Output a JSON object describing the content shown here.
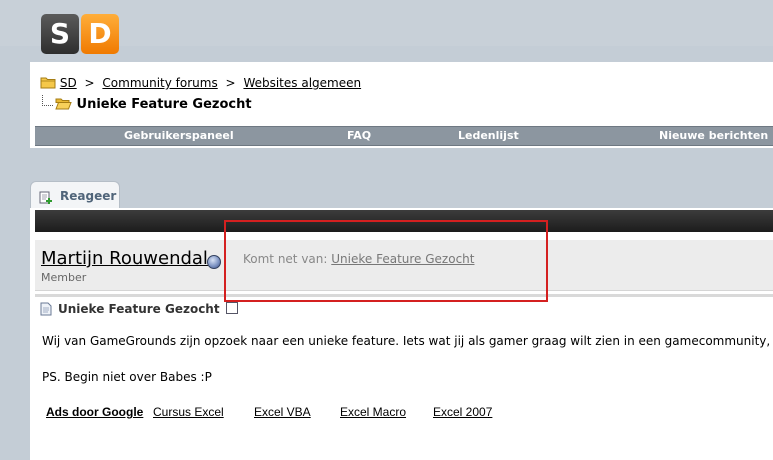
{
  "logo": {
    "letter1": "S",
    "letter2": "D"
  },
  "breadcrumb": {
    "items": [
      "SD",
      "Community forums",
      "Websites algemeen"
    ],
    "separator": ">",
    "current": "Unieke Feature Gezocht"
  },
  "nav": {
    "items": [
      "Gebruikerspaneel",
      "FAQ",
      "Ledenlijst",
      "Nieuwe berichten"
    ]
  },
  "tab": {
    "label": "Reageer"
  },
  "post": {
    "username": "Martijn Rouwendal",
    "role": "Member",
    "from_label": "Komt net van:",
    "from_link": "Unieke Feature Gezocht",
    "title": "Unieke Feature Gezocht",
    "body": "Wij van GameGrounds zijn opzoek naar een unieke feature. Iets wat jij als gamer graag wilt zien in een gamecommunity, m",
    "ps": "PS. Begin niet over Babes :P"
  },
  "ads": {
    "label": "Ads door Google",
    "links": [
      "Cursus Excel",
      "Excel VBA",
      "Excel Macro",
      "Excel 2007"
    ]
  },
  "colors": {
    "highlight": "#d42020",
    "accent": "#f07a00",
    "nav_bg": "#8c96a0"
  }
}
